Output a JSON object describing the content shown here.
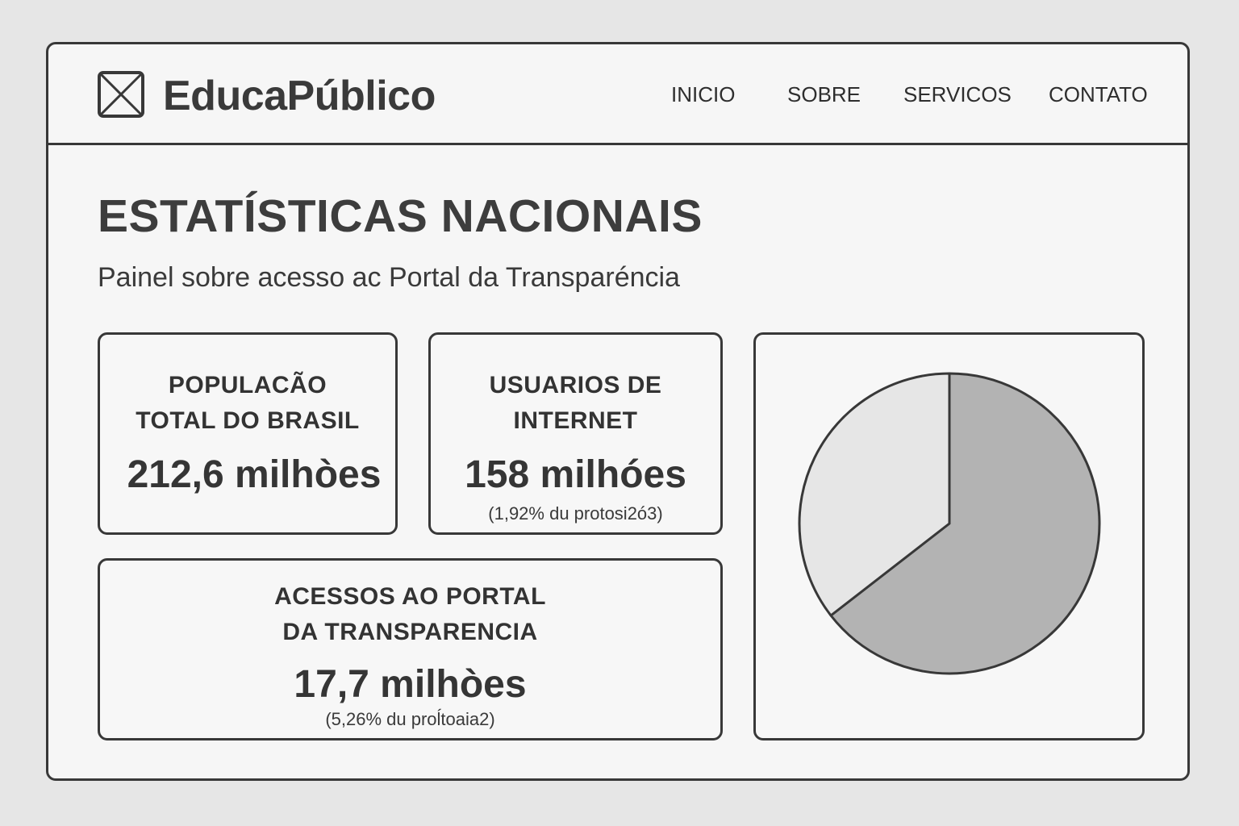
{
  "header": {
    "brand": "EducaPúblico",
    "nav": [
      "INICIO",
      "SOBRE",
      "SERVICOS",
      "CONTATO"
    ]
  },
  "main": {
    "title": "ESTATÍSTICAS NACIONAIS",
    "subtitle": "Painel sobre acesso ac Portal da Transparéncia"
  },
  "cards": {
    "population": {
      "label_line1": "POPULACÃO",
      "label_line2": "TOTAL DO BRASIL",
      "value": "212,6 milhòes"
    },
    "internet_users": {
      "label_line1": "USUARIOS DE",
      "label_line2": "INTERNET",
      "value": "158 milhóes",
      "note": "(1,92% du protosi2ó3)"
    },
    "portal_access": {
      "label_line1": "ACESSOS AO PORTAL",
      "label_line2": "DA TRANSPARENCIA",
      "value": "17,7 milhòes",
      "note": "(5,26% du proĺtoaia2)"
    }
  },
  "colors": {
    "border": "#383838",
    "background": "#f6f6f6",
    "pie_dark": "#b3b3b3",
    "pie_light": "#e6e6e6"
  },
  "chart_data": {
    "type": "pie",
    "slices": [
      {
        "value": 64.5,
        "color": "#b3b3b3"
      },
      {
        "value": 35.5,
        "color": "#e6e6e6"
      }
    ]
  }
}
